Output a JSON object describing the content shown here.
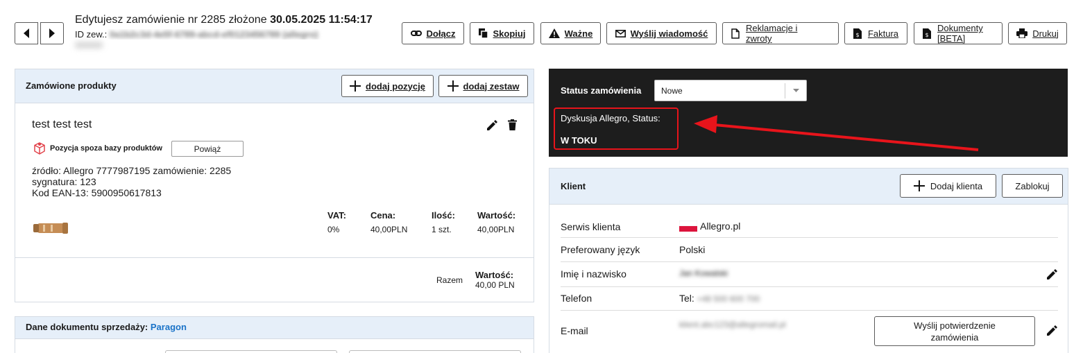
{
  "header": {
    "title_prefix": "Edytujesz zamówienie nr 2285 złożone",
    "title_date": "30.05.2025 11:54:17",
    "id_label": "ID zew.:",
    "id_value": "0a1b2c3d-4e5f-6789-abcd-ef0123456789 (allegro)"
  },
  "toolbar": [
    {
      "name": "attach-button",
      "icon": "link-icon",
      "label": "Dołącz"
    },
    {
      "name": "copy-button",
      "icon": "copy-icon",
      "label": "Skopiuj"
    },
    {
      "name": "important-button",
      "icon": "warning-icon",
      "label": "Ważne"
    },
    {
      "name": "send-message-button",
      "icon": "envelope-icon",
      "label": "Wyślij wiadomość"
    },
    {
      "name": "complaints-button",
      "icon": "document-icon",
      "label": "Reklamacje i zwroty"
    },
    {
      "name": "invoice-button",
      "icon": "invoice-icon",
      "label": "Faktura"
    },
    {
      "name": "documents-button",
      "icon": "invoice-icon",
      "label": "Dokumenty [BETA]"
    },
    {
      "name": "print-button",
      "icon": "printer-icon",
      "label": "Drukuj"
    }
  ],
  "products": {
    "title": "Zamówione produkty",
    "add_item": "dodaj pozycję",
    "add_set": "dodaj zestaw",
    "item": {
      "name": "test test test",
      "badge": "Pozycja spoza bazy produktów",
      "link_button": "Powiąż",
      "source": "źródło: Allegro 7777987195 zamówienie: 2285",
      "signature": "sygnatura: 123",
      "ean": "Kod EAN-13: 5900950617813",
      "vat_label": "VAT:",
      "vat_value": "0%",
      "price_label": "Cena:",
      "price_value": "40,00PLN",
      "qty_label": "Ilość:",
      "qty_value": "1 szt.",
      "value_label": "Wartość:",
      "value_value": "40,00PLN"
    },
    "sum_label": "Razem",
    "sum_value_label": "Wartość:",
    "sum_value": "40,00 PLN"
  },
  "sales_doc": {
    "label": "Dane dokumentu sprzedaży:",
    "value": "Paragon"
  },
  "status": {
    "label": "Status zamówienia",
    "selected": "Nowe",
    "discussion_label": "Dyskusja Allegro, Status:",
    "discussion_value": "W TOKU"
  },
  "client": {
    "title": "Klient",
    "add_client": "Dodaj klienta",
    "block": "Zablokuj",
    "rows": {
      "service_label": "Serwis klienta",
      "service_value": "Allegro.pl",
      "lang_label": "Preferowany język",
      "lang_value": "Polski",
      "name_label": "Imię i nazwisko",
      "name_value": "Jan Kowalski",
      "phone_label": "Telefon",
      "phone_prefix": "Tel:",
      "phone_value": "+48 500 600 700",
      "email_label": "E-mail",
      "email_value": "klient.abc123@allegromail.pl",
      "send_confirm": "Wyślij potwierdzenie zamówienia"
    }
  },
  "colors": {
    "accent_blue": "#1a73c8",
    "panel_header": "#e6eff9",
    "dark_panel": "#1d1d1d",
    "highlight_red": "#e8141b"
  }
}
